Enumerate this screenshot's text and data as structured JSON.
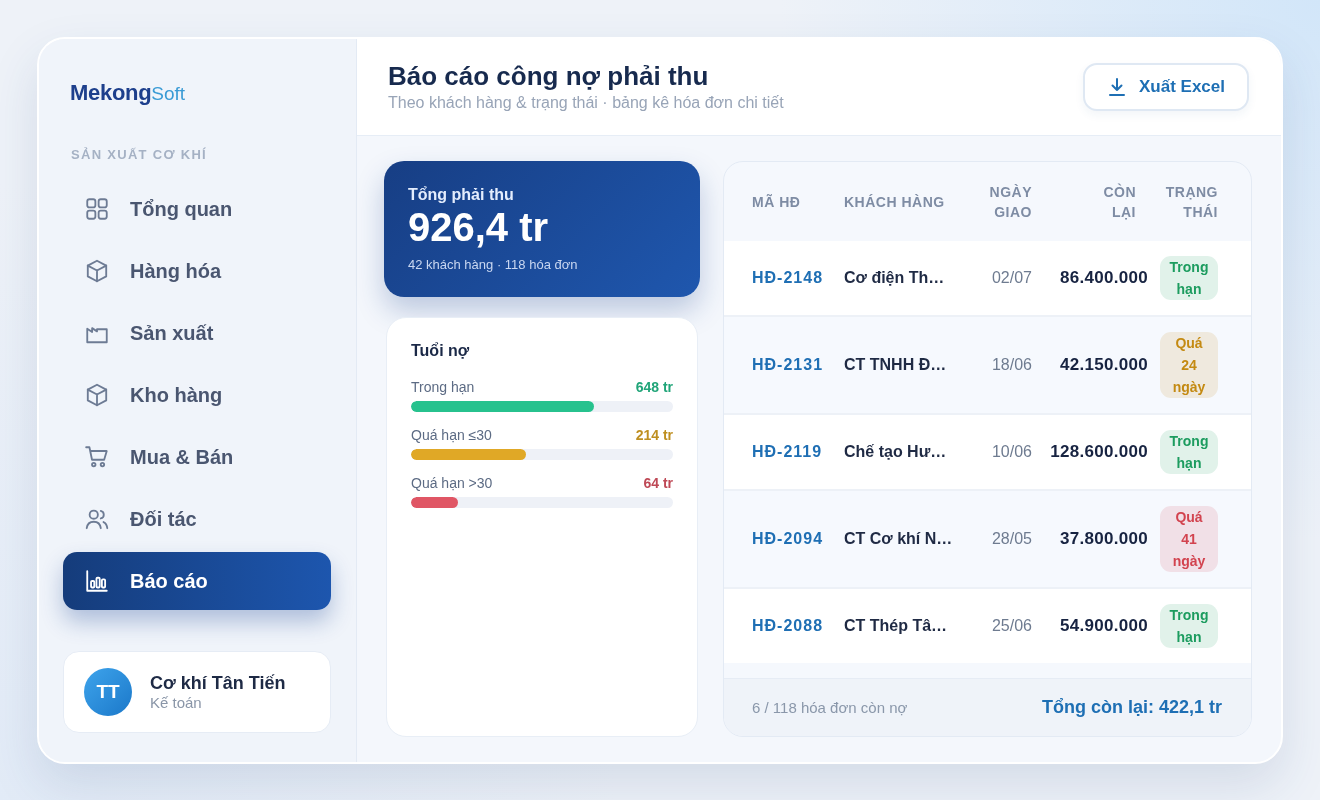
{
  "sidebar": {
    "logo": {
      "primary": "Mekong",
      "secondary": "Soft"
    },
    "section_label": "SẢN XUẤT CƠ KHÍ",
    "items": [
      {
        "label": "Tổng quan",
        "selected": false
      },
      {
        "label": "Hàng hóa",
        "selected": false
      },
      {
        "label": "Sản xuất",
        "selected": false
      },
      {
        "label": "Kho hàng",
        "selected": false
      },
      {
        "label": "Mua & Bán",
        "selected": false
      },
      {
        "label": "Đối tác",
        "selected": false
      },
      {
        "label": "Báo cáo",
        "selected": true
      }
    ],
    "user": {
      "initials": "TT",
      "name": "Cơ khí Tân Tiến",
      "role": "Kế toán"
    }
  },
  "header": {
    "title": "Báo cáo công nợ phải thu",
    "subtitle": "Theo khách hàng & trạng thái · bảng kê hóa đơn chi tiết",
    "export_button": "Xuất Excel"
  },
  "summary": {
    "label": "Tổng phải thu",
    "value": "926,4 tr",
    "detail": "42 khách hàng · 118 hóa đơn"
  },
  "aging": {
    "title": "Tuổi nợ",
    "rows": [
      {
        "label": "Trong hạn",
        "value": "648 tr",
        "level": 0.7,
        "color": "#27c28e"
      },
      {
        "label": "Quá hạn ≤30",
        "value": "214 tr",
        "level": 0.44,
        "color": "#e0a826"
      },
      {
        "label": "Quá hạn >30",
        "value": "64 tr",
        "level": 0.18,
        "color": "#e05665"
      }
    ]
  },
  "table": {
    "columns": [
      "MÃ HĐ",
      "KHÁCH HÀNG",
      "NGÀY GIAO",
      "CÒN LẠI",
      "TRẠNG THÁI"
    ],
    "rows": [
      {
        "code": "HĐ-2148",
        "customer": "Cơ điện Th…",
        "date": "02/07",
        "remaining": "86.400.000",
        "status": {
          "text": "Trong hạn",
          "color": "#1c9c5f"
        }
      },
      {
        "code": "HĐ-2131",
        "customer": "CT TNHH Đ…",
        "date": "18/06",
        "remaining": "42.150.000",
        "status": {
          "text": "Quá 24 ngày",
          "color": "#c48a12"
        }
      },
      {
        "code": "HĐ-2119",
        "customer": "Chế tạo Hư…",
        "date": "10/06",
        "remaining": "128.600.000",
        "status": {
          "text": "Trong hạn",
          "color": "#1c9c5f"
        }
      },
      {
        "code": "HĐ-2094",
        "customer": "CT Cơ khí N…",
        "date": "28/05",
        "remaining": "37.800.000",
        "status": {
          "text": "Quá 41 ngày",
          "color": "#d2434f"
        }
      },
      {
        "code": "HĐ-2088",
        "customer": "CT Thép Tâ…",
        "date": "25/06",
        "remaining": "54.900.000",
        "status": {
          "text": "Trong hạn",
          "color": "#1c9c5f"
        }
      }
    ],
    "footer": {
      "count": "6 / 118 hóa đơn còn nợ",
      "total": "Tổng còn lại: 422,1 tr"
    }
  }
}
